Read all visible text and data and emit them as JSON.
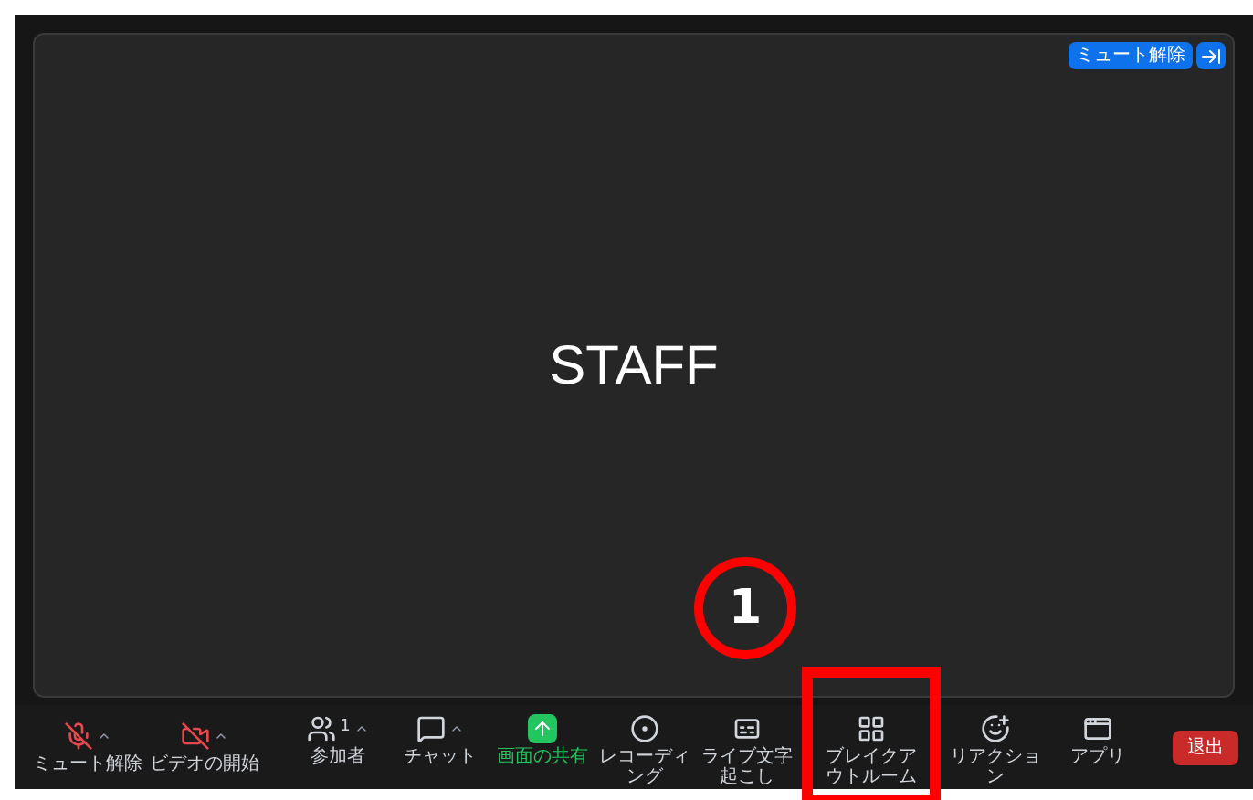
{
  "top_bar": {
    "unmute_button": "ミュート解除"
  },
  "stage": {
    "name": "STAFF"
  },
  "toolbar": {
    "audio": {
      "label": "ミュート解除",
      "muted": true
    },
    "video": {
      "label": "ビデオの開始",
      "off": true
    },
    "items": [
      {
        "kind": "participants",
        "label": "参加者",
        "count": "1",
        "caret": true,
        "highlighted": false,
        "framed": false
      },
      {
        "kind": "chat",
        "label": "チャット",
        "caret": true,
        "highlighted": false,
        "framed": false
      },
      {
        "kind": "share",
        "label": "画面の共有",
        "caret": false,
        "highlighted": true,
        "framed": false
      },
      {
        "kind": "record",
        "label": "レコーディング",
        "caret": false,
        "highlighted": false,
        "framed": false
      },
      {
        "kind": "captions",
        "label": "ライブ文字起こし",
        "caret": false,
        "highlighted": false,
        "framed": false
      },
      {
        "kind": "breakout",
        "label": "ブレイクアウトルーム",
        "caret": false,
        "highlighted": false,
        "framed": true
      },
      {
        "kind": "reactions",
        "label": "リアクション",
        "caret": false,
        "highlighted": false,
        "framed": false
      },
      {
        "kind": "apps",
        "label": "アプリ",
        "caret": false,
        "highlighted": false,
        "framed": false
      }
    ],
    "leave_button": "退出"
  },
  "annotation": {
    "step": "1"
  }
}
